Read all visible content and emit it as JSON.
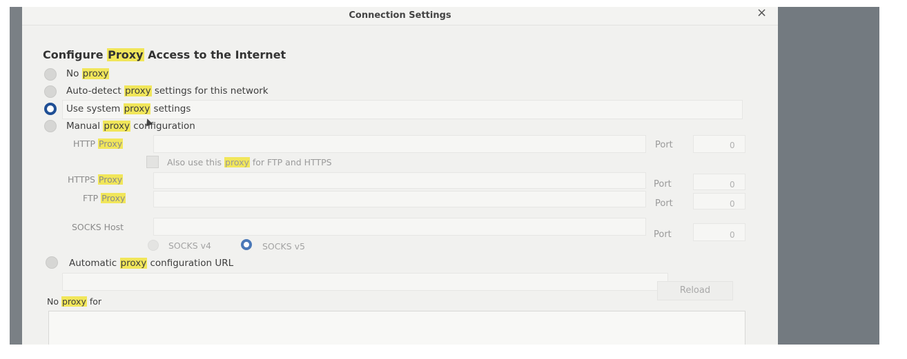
{
  "window": {
    "title": "Connection Settings",
    "close_label": "×"
  },
  "section": {
    "heading_pre": "Configure ",
    "heading_hl": "Proxy",
    "heading_post": " Access to the Internet"
  },
  "options": {
    "no_proxy": {
      "pre": "No ",
      "hl": "proxy",
      "post": ""
    },
    "auto_detect": {
      "pre": "Auto-detect ",
      "hl": "proxy",
      "post": " settings for this network"
    },
    "use_system": {
      "pre": "Use system ",
      "hl": "proxy",
      "post": " settings"
    },
    "manual": {
      "pre": "Manual ",
      "hl": "proxy",
      "post": " configuration"
    },
    "auto_url": {
      "pre": "Automatic ",
      "hl": "proxy",
      "post": " configuration URL"
    }
  },
  "manual": {
    "http": {
      "pre": "HTTP ",
      "hl": "Proxy"
    },
    "also_use": {
      "pre": "Also use this ",
      "hl": "proxy",
      "post": " for FTP and HTTPS"
    },
    "https": {
      "pre": "HTTPS ",
      "hl": "Proxy"
    },
    "ftp": {
      "pre": "FTP ",
      "hl": "Proxy"
    },
    "socks_label": "SOCKS Host",
    "socks_v4": "SOCKS v4",
    "socks_v5": "SOCKS v5",
    "port_label": "Port",
    "port_value": "0"
  },
  "reload_label": "Reload",
  "no_proxy_for": {
    "pre": "No ",
    "hl": "proxy",
    "post": " for"
  },
  "selected_option": "use_system",
  "selected_socks": "socks_v5",
  "colors": {
    "highlight": "#f1e65a",
    "radio_selected": "#1f4f95",
    "backdrop": "#737a80"
  }
}
